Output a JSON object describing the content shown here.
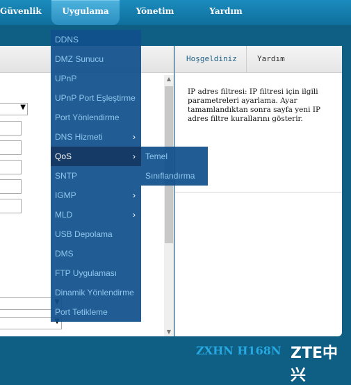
{
  "topnav": {
    "items": [
      {
        "label": "Güvenlik"
      },
      {
        "label": "Uygulama"
      },
      {
        "label": "Yönetim"
      },
      {
        "label": "Yardım"
      }
    ]
  },
  "dropdown": {
    "items": [
      {
        "label": "DDNS"
      },
      {
        "label": "DMZ Sunucu"
      },
      {
        "label": "UPnP"
      },
      {
        "label": "UPnP Port Eşleştirme"
      },
      {
        "label": "Port Yönlendirme"
      },
      {
        "label": "DNS Hizmeti"
      },
      {
        "label": "QoS"
      },
      {
        "label": "SNTP"
      },
      {
        "label": "IGMP"
      },
      {
        "label": "MLD"
      },
      {
        "label": "USB Depolama"
      },
      {
        "label": "DMS"
      },
      {
        "label": "FTP Uygulaması"
      },
      {
        "label": "Dinamik Yönlendirme"
      },
      {
        "label": "Port Tetikleme"
      }
    ],
    "submenu": [
      {
        "label": "Temel"
      },
      {
        "label": "Sınıflandırma"
      }
    ]
  },
  "help": {
    "tab_welcome": "Hoşgeldiniz",
    "tab_help": "Yardım",
    "text": "IP adres filtresi: IP filtresi için ilgili parametreleri ayarlama. Ayar tamamlandıktan sonra sayfa yeni IP adres filtre kurallarını gösterir."
  },
  "icons": {
    "submenu_arrow": "chevron-right-icon",
    "select_arrow": "triangle-down-icon",
    "scroll_up": "triangle-up-icon",
    "scroll_down": "triangle-down-icon"
  },
  "footer": {
    "model": "ZXHN H168N",
    "brand": "ZTE中兴"
  },
  "colors": {
    "background": "#0f5e84",
    "menu": "#10508c",
    "menu_active": "#163a66",
    "menu_text": "#8ec6ec",
    "tab_text": "#1f5f86",
    "model_text": "#26a9e0"
  }
}
